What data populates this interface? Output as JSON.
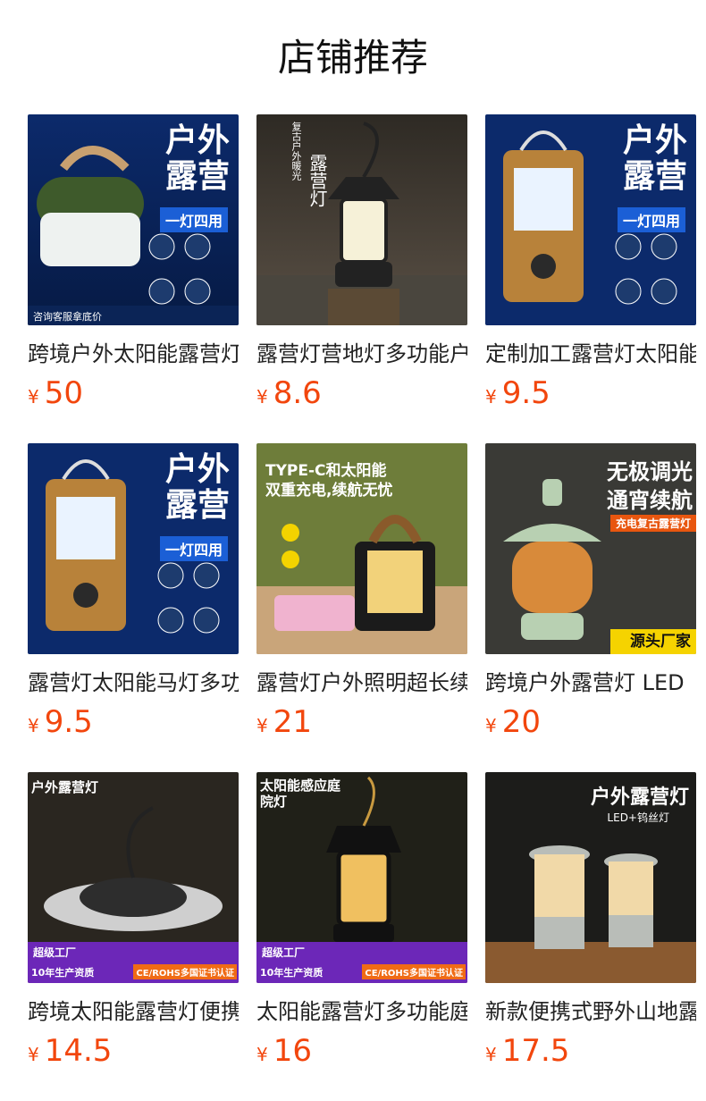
{
  "page": {
    "title": "店铺推荐"
  },
  "currency": "¥",
  "products": [
    {
      "name": "跨境户外太阳能露营灯多功能",
      "price": "50",
      "image_text": {
        "headline1": "户外",
        "headline2": "露营",
        "tag": "一灯四用",
        "footer": "咨询客服拿底价"
      }
    },
    {
      "name": "露营灯营地灯多功能户外",
      "price": "8.6",
      "image_text": {
        "side": "复古户外暖光",
        "headline": "露营灯"
      }
    },
    {
      "name": "定制加工露营灯太阳能",
      "price": "9.5",
      "image_text": {
        "headline1": "户外",
        "headline2": "露营",
        "tag": "一灯四用"
      }
    },
    {
      "name": "露营灯太阳能马灯多功能",
      "price": "9.5",
      "image_text": {
        "headline1": "户外",
        "headline2": "露营",
        "tag": "一灯四用"
      }
    },
    {
      "name": "露营灯户外照明超长续航",
      "price": "21",
      "image_text": {
        "headline1": "TYPE-C和太阳能",
        "headline2": "双重充电,续航无忧"
      }
    },
    {
      "name": "跨境户外露营灯 LED",
      "price": "20",
      "image_text": {
        "headline1": "无极调光",
        "headline2": "通宵续航",
        "tag": "充电复古露营灯",
        "footer": "源头厂家"
      }
    },
    {
      "name": "跨境太阳能露营灯便携",
      "price": "14.5",
      "image_text": {
        "headline": "户外露营灯",
        "badge": "超级工厂",
        "badge2": "10年生产资质",
        "badge3": "CE/ROHS多国证书认证"
      }
    },
    {
      "name": "太阳能露营灯多功能庭院",
      "price": "16",
      "image_text": {
        "headline": "太阳能感应庭院灯",
        "badge": "超级工厂",
        "badge2": "10年生产资质",
        "badge3": "CE/ROHS多国证书认证"
      }
    },
    {
      "name": "新款便携式野外山地露营",
      "price": "17.5",
      "image_text": {
        "headline": "户外露营灯",
        "sub": "LED+钨丝灯"
      }
    }
  ]
}
